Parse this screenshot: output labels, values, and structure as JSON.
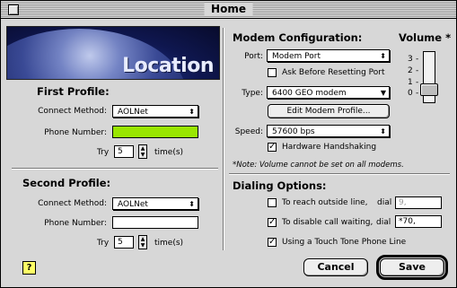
{
  "window": {
    "title": "Home"
  },
  "banner": {
    "text": "Location"
  },
  "first_profile": {
    "heading": "First Profile:",
    "connect_label": "Connect Method:",
    "connect_value": "AOLNet",
    "phone_label": "Phone Number:",
    "phone_value": "",
    "try_label": "Try",
    "try_value": "5",
    "times_label": "time(s)"
  },
  "second_profile": {
    "heading": "Second Profile:",
    "connect_label": "Connect Method:",
    "connect_value": "AOLNet",
    "phone_label": "Phone Number:",
    "phone_value": "",
    "try_label": "Try",
    "try_value": "5",
    "times_label": "time(s)"
  },
  "modem": {
    "heading": "Modem Configuration:",
    "port_label": "Port:",
    "port_value": "Modem Port",
    "ask_reset_label": "Ask Before Resetting Port",
    "ask_reset_checked": false,
    "type_label": "Type:",
    "type_value": "6400 GEO modem",
    "edit_button": "Edit Modem Profile...",
    "speed_label": "Speed:",
    "speed_value": "57600 bps",
    "handshaking_label": "Hardware Handshaking",
    "handshaking_checked": true,
    "note": "*Note: Volume cannot be set on all modems."
  },
  "volume": {
    "heading": "Volume *",
    "ticks": [
      "3",
      "2",
      "1",
      "0"
    ],
    "level": 0
  },
  "dialing": {
    "heading": "Dialing Options:",
    "outside_label": "To reach outside line,",
    "outside_dial_label": "dial",
    "outside_value": "9,",
    "outside_checked": false,
    "call_waiting_label": "To disable call waiting,",
    "call_waiting_dial_label": "dial",
    "call_waiting_value": "*70,",
    "call_waiting_checked": true,
    "touch_tone_label": "Using a Touch Tone Phone Line",
    "touch_tone_checked": true
  },
  "buttons": {
    "cancel": "Cancel",
    "save": "Save",
    "help": "?"
  },
  "icons": {
    "close": "close-box-icon",
    "popup": "popup-arrow-icon",
    "stepper": "stepper-icon",
    "help": "help-icon"
  }
}
